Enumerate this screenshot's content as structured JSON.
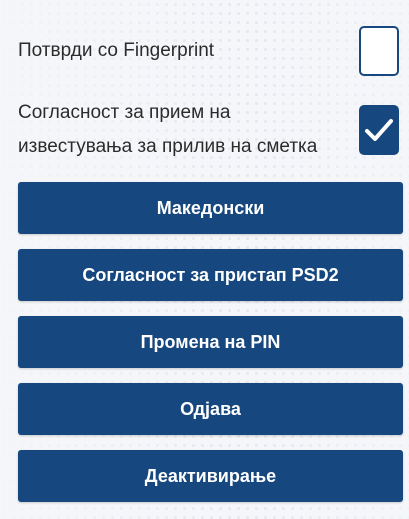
{
  "settings": {
    "fingerprint": {
      "label": "Потврди со Fingerprint",
      "checked": false
    },
    "inflow_notifications": {
      "label": "Согласност за прием на известувања за прилив на сметка",
      "checked": true
    }
  },
  "buttons": {
    "language": "Македонски",
    "psd2_consent": "Согласност за пристап PSD2",
    "change_pin": "Промена на PIN",
    "logout": "Одјава",
    "deactivate": "Деактивирање"
  },
  "colors": {
    "primary": "#17477f",
    "text": "#2b2b2b",
    "background": "#f4f6f9"
  },
  "icons": {
    "checkmark": "check-icon"
  }
}
